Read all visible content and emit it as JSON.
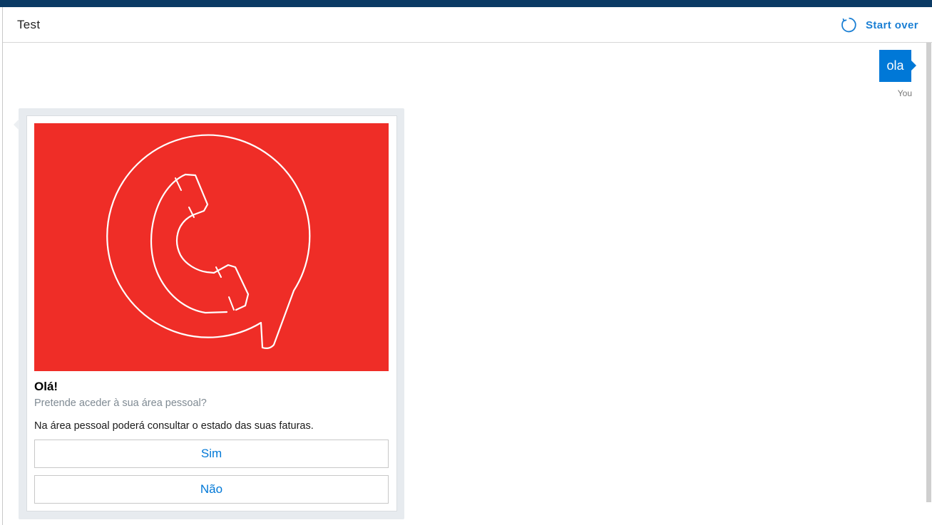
{
  "header": {
    "title": "Test",
    "start_over_label": "Start over",
    "start_over_icon": "refresh-icon"
  },
  "colors": {
    "top_bar": "#0b3a64",
    "accent": "#0078d7",
    "card_image_bg": "#ef2d27"
  },
  "conversation": {
    "user_message": {
      "text": "ola",
      "sender_label": "You"
    },
    "bot_card": {
      "image_icon": "phone-chat-bubble-icon",
      "title": "Olá!",
      "subtitle": "Pretende aceder à sua área pessoal?",
      "text": "Na área pessoal poderá consultar o estado das suas faturas.",
      "buttons": [
        {
          "label": "Sim"
        },
        {
          "label": "Não"
        }
      ]
    }
  }
}
